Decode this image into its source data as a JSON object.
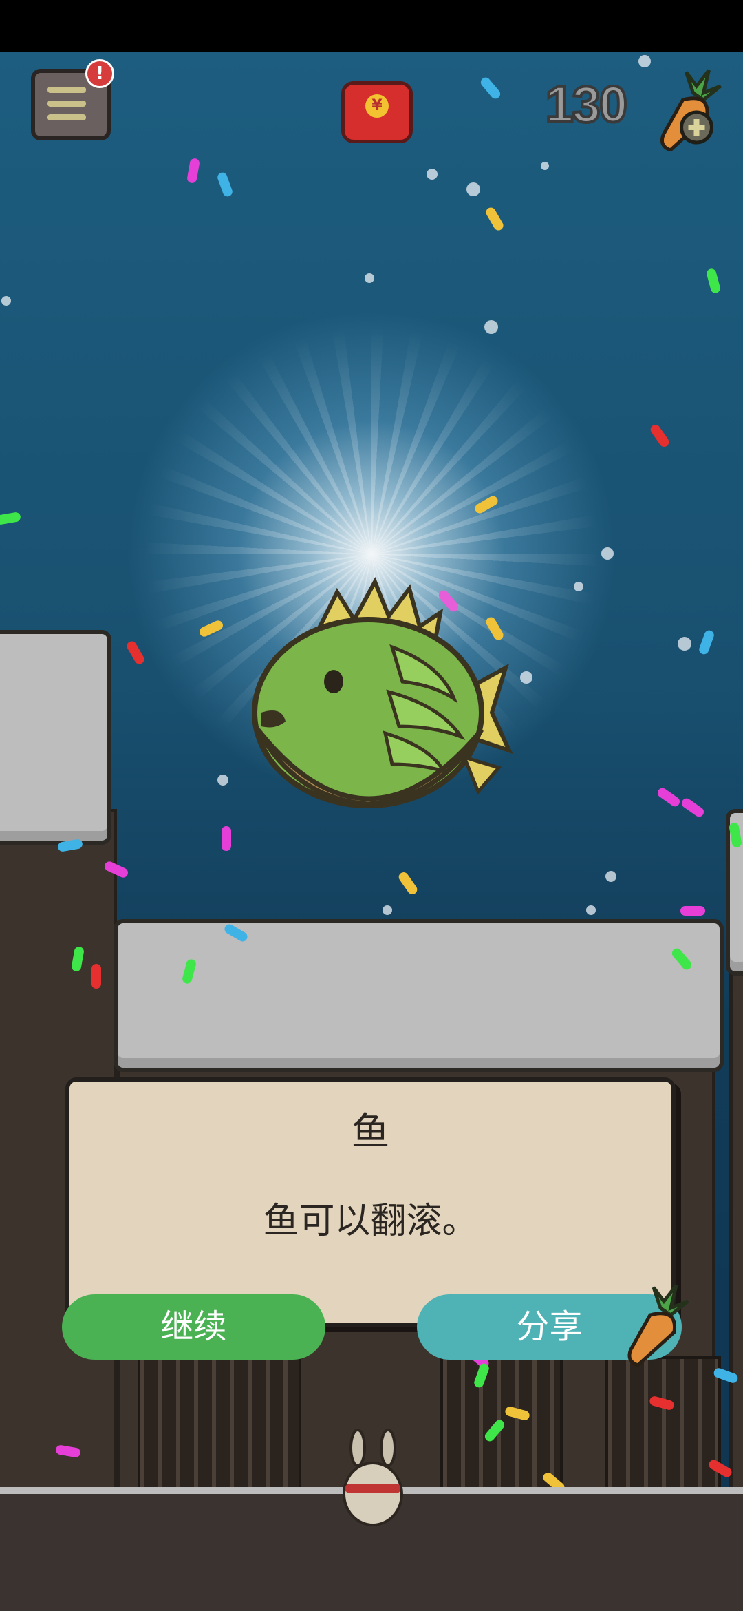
{
  "hud": {
    "carrot_count": "130",
    "menu_badge": "!",
    "red_envelope_symbol": "¥",
    "icons": [
      "menu-icon",
      "red-envelope-icon",
      "carrot-add-icon"
    ]
  },
  "dialog": {
    "title": "鱼",
    "description": "鱼可以翻滚。",
    "continue_label": "继续",
    "share_label": "分享"
  },
  "colors": {
    "sky": "#195070",
    "dialog_bg": "#e3d5bd",
    "continue": "#4bb254",
    "share": "#4fb3b6",
    "fish_green": "#7cb54a"
  }
}
